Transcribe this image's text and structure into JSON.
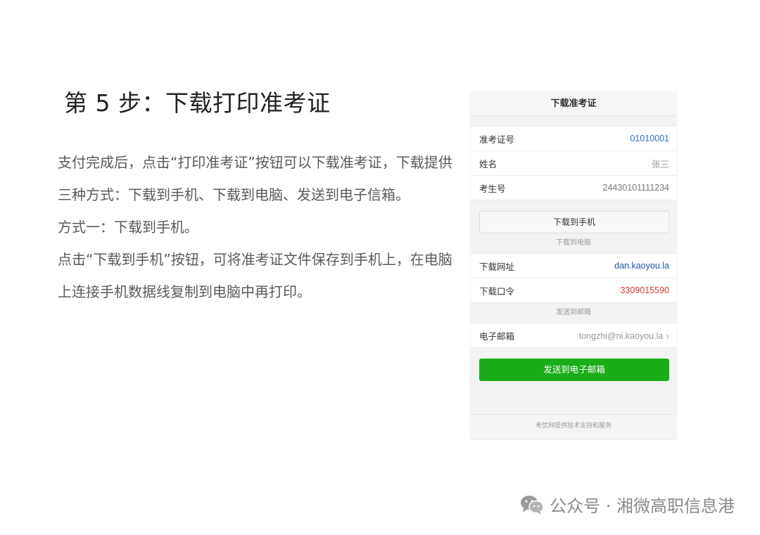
{
  "article": {
    "title": "第 5 步：下载打印准考证",
    "para1": "支付完成后，点击“打印准考证”按钮可以下载准考证，下载提供三种方式：下载到手机、下载到电脑、发送到电子信箱。",
    "para2": "方式一：下载到手机。",
    "para3": "点击“下载到手机”按钮，可将准考证文件保存到手机上，在电脑上连接手机数据线复制到电脑中再打印。"
  },
  "phone": {
    "header_title": "下载准考证",
    "info_rows": [
      {
        "label": "准考证号",
        "value": "01010001"
      },
      {
        "label": "姓名",
        "value": "张三"
      },
      {
        "label": "考生号",
        "value": "24430101111234"
      }
    ],
    "download_phone_button": "下载到手机",
    "download_pc_label": "下载到电脑",
    "pc_rows": [
      {
        "label": "下载网址",
        "value": "dan.kaoyou.la"
      },
      {
        "label": "下载口令",
        "value": "3309015590"
      }
    ],
    "email_section_label": "发送到邮箱",
    "email_row": {
      "label": "电子邮箱",
      "value": "tongzhi@ni.kaoyou.la"
    },
    "send_email_button": "发送到电子邮箱",
    "footer": "考优网提供技术支持和服务"
  },
  "watermark": {
    "text": "公众号 · 湘微高职信息港",
    "icon": "wechat-icon"
  },
  "colors": {
    "accent_green": "#1aad19",
    "value_blue": "#2a6fb8",
    "value_red": "#d43c3c"
  }
}
